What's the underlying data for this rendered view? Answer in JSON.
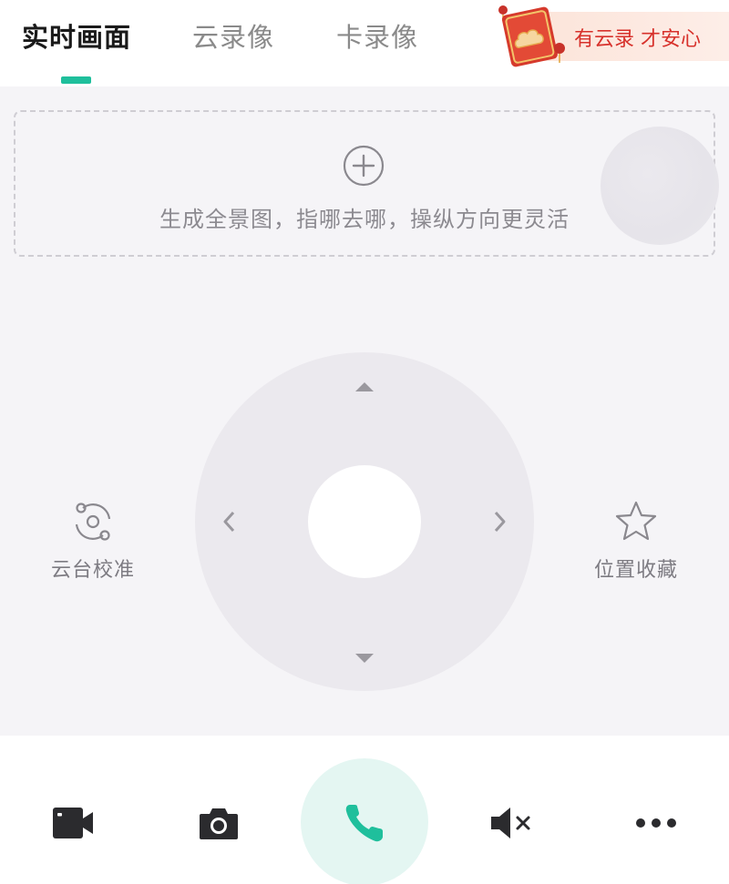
{
  "tabs": [
    {
      "label": "实时画面",
      "active": true
    },
    {
      "label": "云录像",
      "active": false
    },
    {
      "label": "卡录像",
      "active": false
    }
  ],
  "promo": {
    "text": "有云录  才安心"
  },
  "panorama": {
    "hint": "生成全景图，指哪去哪，操纵方向更灵活",
    "icon": "plus-circle-icon"
  },
  "ptz": {
    "calibrate_label": "云台校准",
    "favorite_label": "位置收藏"
  },
  "bottom_bar": {
    "record": "video-camera-icon",
    "snapshot": "camera-icon",
    "call": "phone-icon",
    "mute": "speaker-muted-icon",
    "more": "more-dots-icon"
  },
  "colors": {
    "accent": "#1fbf9c",
    "promo_red": "#d7312b",
    "background": "#f5f4f7"
  }
}
